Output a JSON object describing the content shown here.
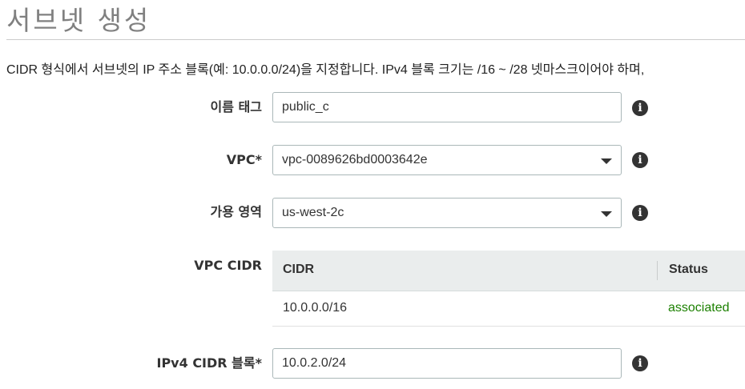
{
  "page": {
    "title": "서브넷 생성",
    "description": "CIDR 형식에서 서브넷의 IP 주소 블록(예: 10.0.0.0/24)을 지정합니다. IPv4 블록 크기는 /16 ~ /28 넷마스크이어야 하며,"
  },
  "form": {
    "name_tag": {
      "label": "이름 태그",
      "value": "public_c"
    },
    "vpc": {
      "label": "VPC*",
      "value": "vpc-0089626bd0003642e"
    },
    "availability_zone": {
      "label": "가용 영역",
      "value": "us-west-2c"
    },
    "vpc_cidr": {
      "label": "VPC CIDR",
      "columns": [
        "CIDR",
        "Status"
      ],
      "rows": [
        {
          "cidr": "10.0.0.0/16",
          "status": "associated"
        }
      ]
    },
    "ipv4_cidr": {
      "label": "IPv4 CIDR 블록*",
      "value": "10.0.2.0/24"
    }
  },
  "icons": {
    "info": "i"
  },
  "colors": {
    "status_associated": "#1d8102",
    "table_header_bg": "#eaeded"
  }
}
